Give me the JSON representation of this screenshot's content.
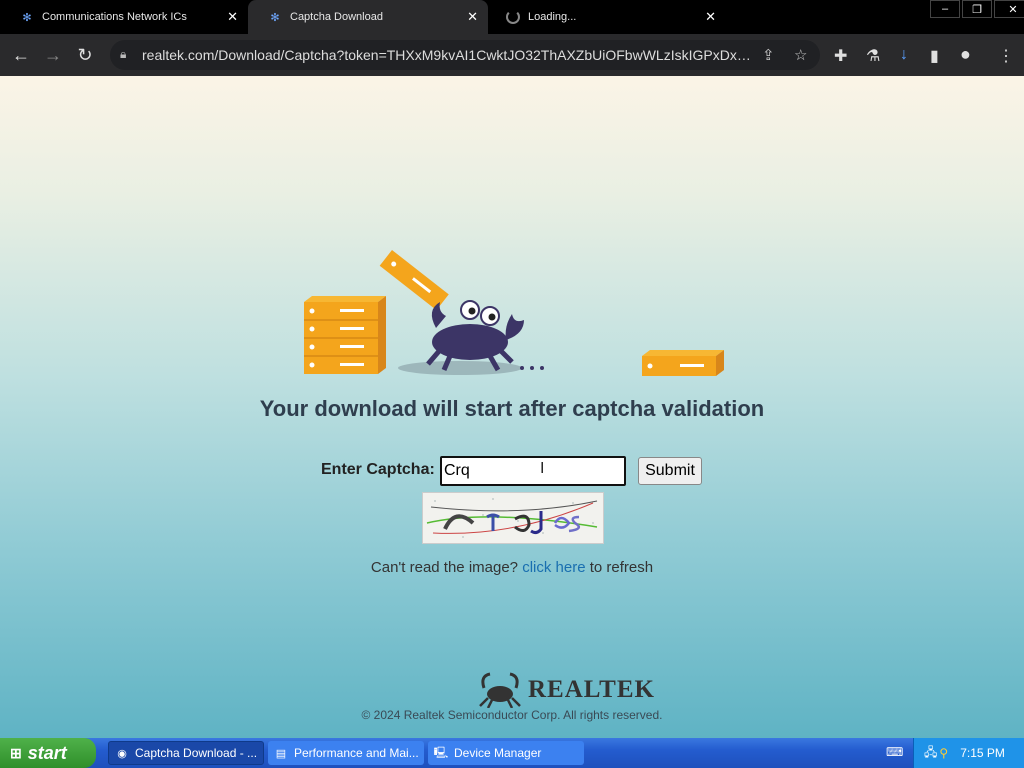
{
  "tabs": [
    {
      "title": "Communications Network ICs",
      "state": "inactive"
    },
    {
      "title": "Captcha Download",
      "state": "active"
    },
    {
      "title": "Loading...",
      "state": "loading"
    }
  ],
  "window_controls": {
    "minimize": "–",
    "restore": "❐",
    "close": "✕"
  },
  "toolbar": {
    "url": "realtek.com/Download/Captcha?token=THXxM9kvAI1CwktJO32ThAXZbUiOFbwWLzIskIGPxDxMb..."
  },
  "page": {
    "headline": "Your download will start after captcha validation",
    "captcha_label": "Enter Captcha:",
    "captcha_value": "Crq",
    "submit_label": "Submit",
    "refresh_prefix": "Can't read the image?",
    "refresh_link": "click here",
    "refresh_suffix": "to refresh",
    "logo_text": "REALTEK",
    "copyright": "© 2024 Realtek Semiconductor Corp. All rights reserved."
  },
  "taskbar": {
    "start_label": "start",
    "tasks": [
      {
        "label": "Captcha Download - ...",
        "icon": "chrome-icon"
      },
      {
        "label": "Performance and Mai...",
        "icon": "control-panel-icon"
      },
      {
        "label": "Device Manager",
        "icon": "device-manager-icon"
      }
    ],
    "clock": "7:15 PM"
  },
  "colors": {
    "accent": "#1a6fb0",
    "headline": "#2f3e4e",
    "taskbar": "#245ccf",
    "start": "#3a9a35"
  }
}
